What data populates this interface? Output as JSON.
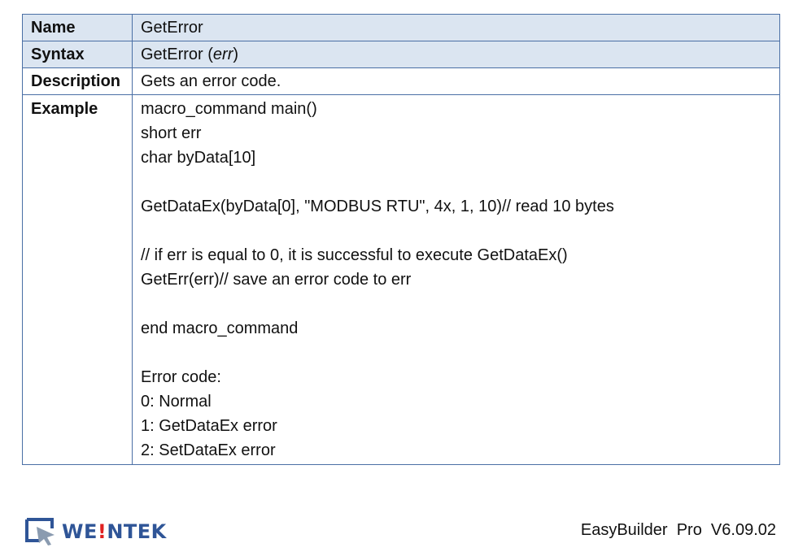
{
  "table": {
    "name_label": "Name",
    "name_value": "GetError",
    "syntax_label": "Syntax",
    "syntax_func": "GetError (",
    "syntax_arg": "err",
    "syntax_close": ")",
    "description_label": "Description",
    "description_value": "Gets an error code.",
    "example_label": "Example",
    "example_lines": [
      "macro_command main()",
      "short err",
      "char byData[10]",
      "",
      "GetDataEx(byData[0], \"MODBUS RTU\", 4x, 1, 10)// read 10 bytes",
      "",
      "// if err is equal to 0, it is successful to execute GetDataEx()",
      "GetErr(err)// save an error code to err",
      "",
      "end macro_command",
      "",
      "Error code:",
      "0: Normal",
      "1: GetDataEx error",
      "2: SetDataEx error"
    ]
  },
  "footer": {
    "logo_text_before": "WE",
    "logo_text_bang": "!",
    "logo_text_after": "NTEK",
    "version": "EasyBuilder  Pro  V6.09.02"
  },
  "colors": {
    "border": "#4a6fa5",
    "header_shade": "#dbe5f1",
    "logo_blue": "#2f5597",
    "logo_red": "#e02020"
  }
}
